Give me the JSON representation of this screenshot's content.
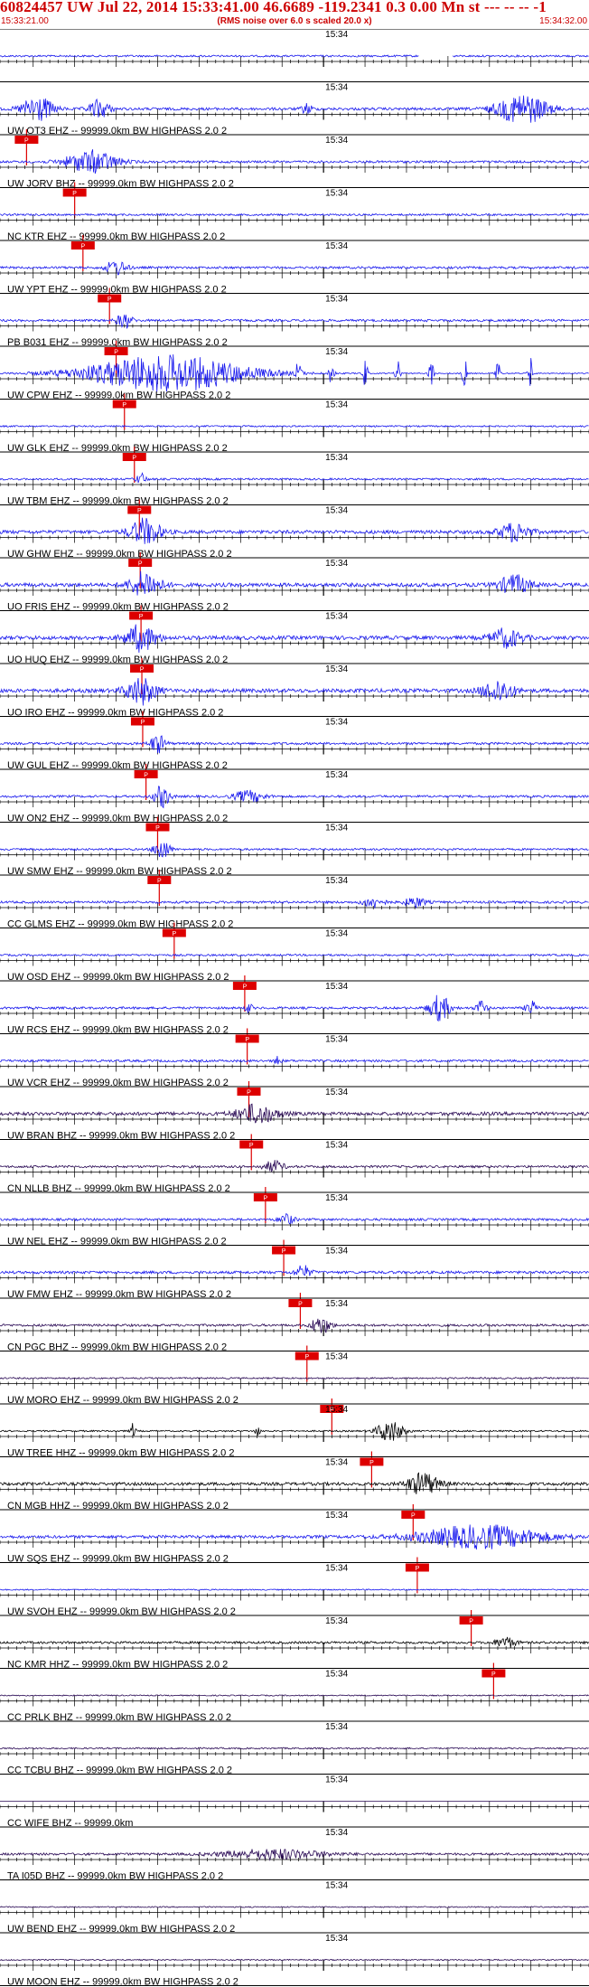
{
  "header": {
    "title": "60824457 UW Jul 22, 2014 15:33:41.00   46.6689 -119.2341  0.3 0.00 Mn st --- -- --  -1",
    "start_time": "15:33:21.00",
    "noise_note": "(RMS noise over 6.0 s scaled 20.0 x)",
    "end_time": "15:34:32.00"
  },
  "chart_data": {
    "type": "line",
    "description_time_axis": "one minute tick mark labelled 15:34 on every trace",
    "time_start": "15:33:21.00",
    "time_end": "15:34:32.00",
    "minute_tick_label": "15:34",
    "minute_tick_seconds": 39,
    "duration_seconds": 71,
    "colors": {
      "blue": "#1a1aee",
      "dark": "#2a0a55",
      "black": "#000000",
      "pick": "#dd0000"
    },
    "traces": [
      {
        "label": "",
        "pick": "",
        "pick_sec": null,
        "color": "blue",
        "amp": 0.25,
        "gaps": [
          [
            50.5,
            54.5
          ]
        ],
        "bursts": []
      },
      {
        "label": "UW OT3 EHZ -- 99999.0km BW  HIGHPASS  2.0  2",
        "pick": "P",
        "pick_sec": 3.2,
        "color": "blue",
        "amp": 0.35,
        "gaps": [],
        "bursts": [
          [
            4.5,
            3.0,
            3.5
          ],
          [
            12,
            2.0,
            2.5
          ],
          [
            37,
            1.0,
            1.5
          ],
          [
            63,
            5.0,
            4.0
          ]
        ]
      },
      {
        "label": "UW JORV BHZ -- 99999.0km BW  HIGHPASS  2.0  2",
        "pick": "P",
        "pick_sec": 9.0,
        "color": "blue",
        "amp": 0.3,
        "gaps": [],
        "bursts": [
          [
            11,
            5.0,
            3.0
          ]
        ]
      },
      {
        "label": "NC KTR EHZ -- 99999.0km BW  HIGHPASS  2.0  2",
        "pick": "P",
        "pick_sec": 10.0,
        "color": "blue",
        "amp": 0.25,
        "gaps": [],
        "bursts": []
      },
      {
        "label": "UW YPT EHZ -- 99999.0km BW  HIGHPASS  2.0  2",
        "pick": "P",
        "pick_sec": 13.2,
        "color": "blue",
        "amp": 0.3,
        "gaps": [],
        "bursts": [
          [
            14,
            2.0,
            2.0
          ]
        ]
      },
      {
        "label": "PB B031 EHZ -- 99999.0km BW  HIGHPASS  2.0  2",
        "pick": "P",
        "pick_sec": 14.0,
        "color": "blue",
        "amp": 0.3,
        "gaps": [],
        "bursts": [
          [
            15,
            1.5,
            2.0
          ]
        ]
      },
      {
        "label": "UW CPW EHZ -- 99999.0km BW  HIGHPASS  2.0  2",
        "pick": "P",
        "pick_sec": 15.0,
        "color": "blue",
        "amp": 0.15,
        "gaps": [],
        "bursts": [
          [
            20,
            16.0,
            5.0
          ],
          [
            36,
            0.5,
            4.0
          ],
          [
            40,
            0.5,
            4.0
          ],
          [
            44,
            0.5,
            4.0
          ],
          [
            48,
            0.5,
            4.0
          ],
          [
            52,
            0.5,
            4.0
          ],
          [
            56,
            0.5,
            4.0
          ],
          [
            60,
            0.5,
            4.0
          ],
          [
            64,
            0.5,
            4.0
          ]
        ]
      },
      {
        "label": "UW GLK EHZ -- 99999.0km BW  HIGHPASS  2.0  2",
        "pick": "P",
        "pick_sec": 16.2,
        "color": "blue",
        "amp": 0.2,
        "gaps": [],
        "bursts": []
      },
      {
        "label": "UW TBM EHZ -- 99999.0km BW  HIGHPASS  2.0  2",
        "pick": "P",
        "pick_sec": 16.8,
        "color": "blue",
        "amp": 0.25,
        "gaps": [],
        "bursts": [
          [
            17,
            1.0,
            1.5
          ]
        ]
      },
      {
        "label": "UW GHW EHZ -- 99999.0km BW  HIGHPASS  2.0  2",
        "pick": "P",
        "pick_sec": 16.9,
        "color": "blue",
        "amp": 0.45,
        "gaps": [],
        "bursts": [
          [
            17.5,
            3.0,
            3.5
          ],
          [
            62,
            3.0,
            2.5
          ]
        ]
      },
      {
        "label": "UO FRIS EHZ -- 99999.0km BW  HIGHPASS  2.0  2",
        "pick": "P",
        "pick_sec": 17.0,
        "color": "blue",
        "amp": 0.5,
        "gaps": [],
        "bursts": [
          [
            17.5,
            3.0,
            3.5
          ],
          [
            62,
            3.0,
            2.5
          ]
        ]
      },
      {
        "label": "UO HUQ EHZ -- 99999.0km BW  HIGHPASS  2.0  2",
        "pick": "P",
        "pick_sec": 17.1,
        "color": "blue",
        "amp": 0.5,
        "gaps": [],
        "bursts": [
          [
            17,
            3.0,
            3.5
          ],
          [
            61,
            3.0,
            2.5
          ]
        ]
      },
      {
        "label": "UO IRO EHZ -- 99999.0km BW  HIGHPASS  2.0  2",
        "pick": "P",
        "pick_sec": 17.2,
        "color": "blue",
        "amp": 0.5,
        "gaps": [],
        "bursts": [
          [
            17,
            3.0,
            3.5
          ],
          [
            60,
            3.0,
            3.0
          ]
        ]
      },
      {
        "label": "UW GUL EHZ -- 99999.0km BW  HIGHPASS  2.0  2",
        "pick": "P",
        "pick_sec": 17.6,
        "color": "blue",
        "amp": 0.3,
        "gaps": [],
        "bursts": [
          [
            19,
            1.5,
            2.5
          ]
        ]
      },
      {
        "label": "UW ON2 EHZ -- 99999.0km BW  HIGHPASS  2.0  2",
        "pick": "P",
        "pick_sec": 19.0,
        "color": "blue",
        "amp": 0.3,
        "gaps": [],
        "bursts": [
          [
            19.5,
            1.5,
            3.0
          ],
          [
            30,
            3.0,
            1.5
          ]
        ]
      },
      {
        "label": "UW SMW EHZ -- 99999.0km BW  HIGHPASS  2.0  2",
        "pick": "P",
        "pick_sec": 19.2,
        "color": "blue",
        "amp": 0.25,
        "gaps": [],
        "bursts": [
          [
            19.5,
            1.5,
            3.0
          ]
        ]
      },
      {
        "label": "CC GLMS EHZ -- 99999.0km BW  HIGHPASS  2.0  2",
        "pick": "P",
        "pick_sec": 21.0,
        "color": "blue",
        "amp": 0.3,
        "gaps": [],
        "bursts": [
          [
            45,
            2.0,
            1.5
          ],
          [
            50,
            2.0,
            1.4
          ]
        ]
      },
      {
        "label": "UW OSD EHZ -- 99999.0km BW  HIGHPASS  2.0  2",
        "pick": "P",
        "pick_sec": 29.5,
        "color": "blue",
        "amp": 0.25,
        "gaps": [],
        "bursts": []
      },
      {
        "label": "UW RCS EHZ -- 99999.0km BW  HIGHPASS  2.0  2",
        "pick": "P",
        "pick_sec": 29.8,
        "color": "blue",
        "amp": 0.3,
        "gaps": [],
        "bursts": [
          [
            30,
            0.6,
            1.5
          ],
          [
            53,
            2.0,
            3.5
          ],
          [
            58,
            1.0,
            2.0
          ],
          [
            64,
            1.0,
            2.0
          ]
        ]
      },
      {
        "label": "UW VCR EHZ -- 99999.0km BW  HIGHPASS  2.0  2",
        "pick": "P",
        "pick_sec": 30.0,
        "color": "blue",
        "amp": 0.3,
        "gaps": [],
        "bursts": [
          [
            33.5,
            0.6,
            1.5
          ]
        ]
      },
      {
        "label": "UW BRAN BHZ -- 99999.0km BW  HIGHPASS  2.0  2",
        "pick": "P",
        "pick_sec": 30.3,
        "color": "dark",
        "amp": 0.45,
        "gaps": [],
        "bursts": [
          [
            31,
            4.0,
            2.5
          ]
        ]
      },
      {
        "label": "CN NLLB BHZ -- 99999.0km BW  HIGHPASS  2.0  2",
        "pick": "P",
        "pick_sec": 32.0,
        "color": "dark",
        "amp": 0.3,
        "gaps": [],
        "bursts": [
          [
            33,
            2.0,
            1.5
          ]
        ]
      },
      {
        "label": "UW NEL EHZ -- 99999.0km BW  HIGHPASS  2.0  2",
        "pick": "P",
        "pick_sec": 34.2,
        "color": "blue",
        "amp": 0.3,
        "gaps": [],
        "bursts": [
          [
            34.5,
            1.5,
            1.5
          ]
        ]
      },
      {
        "label": "UW FMW EHZ -- 99999.0km BW  HIGHPASS  2.0  2",
        "pick": "P",
        "pick_sec": 36.2,
        "color": "blue",
        "amp": 0.35,
        "gaps": [],
        "bursts": [
          [
            36.5,
            1.5,
            1.8
          ]
        ]
      },
      {
        "label": "CN PGC BHZ -- 99999.0km BW  HIGHPASS  2.0  2",
        "pick": "P",
        "pick_sec": 37.0,
        "color": "dark",
        "amp": 0.3,
        "gaps": [],
        "bursts": [
          [
            38,
            1.0,
            1.3
          ],
          [
            39,
            1.5,
            2.0
          ]
        ]
      },
      {
        "label": "UW MORO EHZ -- 99999.0km BW  HIGHPASS  2.0  2",
        "pick": "P",
        "pick_sec": 40.0,
        "color": "dark",
        "amp": 0.2,
        "gaps": [],
        "bursts": []
      },
      {
        "label": "UW TREE HHZ -- 99999.0km BW  HIGHPASS  2.0  2",
        "pick": "P",
        "pick_sec": 44.8,
        "color": "black",
        "amp": 0.2,
        "gaps": [],
        "bursts": [
          [
            16,
            0.5,
            2.0
          ],
          [
            31,
            0.5,
            1.5
          ],
          [
            47,
            2.5,
            3.0
          ]
        ]
      },
      {
        "label": "CN MGB HHZ -- 99999.0km BW  HIGHPASS  2.0  2",
        "pick": "P",
        "pick_sec": 49.8,
        "color": "black",
        "amp": 0.4,
        "gaps": [],
        "bursts": [
          [
            51,
            3.0,
            3.0
          ]
        ]
      },
      {
        "label": "UW SQS EHZ -- 99999.0km BW  HIGHPASS  2.0  2",
        "pick": "P",
        "pick_sec": 50.3,
        "color": "blue",
        "amp": 0.4,
        "gaps": [],
        "bursts": [
          [
            58,
            12.0,
            3.0
          ]
        ]
      },
      {
        "label": "UW SVOH EHZ -- 99999.0km BW  HIGHPASS  2.0  2",
        "pick": "P",
        "pick_sec": 56.8,
        "color": "blue",
        "amp": 0.15,
        "gaps": [],
        "bursts": []
      },
      {
        "label": "NC KMR HHZ -- 99999.0km BW  HIGHPASS  2.0  2",
        "pick": "P",
        "pick_sec": 59.5,
        "color": "black",
        "amp": 0.3,
        "gaps": [],
        "bursts": [
          [
            61,
            2.0,
            1.5
          ]
        ]
      },
      {
        "label": "CC PRLK BHZ -- 99999.0km BW  HIGHPASS  2.0  2",
        "pick": "",
        "pick_sec": null,
        "color": "dark",
        "amp": 0.15,
        "gaps": [],
        "bursts": []
      },
      {
        "label": "CC TCBU BHZ -- 99999.0km BW  HIGHPASS  2.0  2",
        "pick": "",
        "pick_sec": null,
        "color": "dark",
        "amp": 0.2,
        "gaps": [],
        "bursts": []
      },
      {
        "label": "CC WIFE BHZ -- 99999.0km",
        "pick": "",
        "pick_sec": null,
        "color": "dark",
        "amp": 0.0,
        "gaps": [],
        "bursts": []
      },
      {
        "label": "TA I05D BHZ -- 99999.0km BW  HIGHPASS  2.0  2",
        "pick": "",
        "pick_sec": null,
        "color": "dark",
        "amp": 0.3,
        "gaps": [],
        "bursts": [
          [
            33,
            10.0,
            1.3
          ]
        ]
      },
      {
        "label": "UW BEND EHZ -- 99999.0km BW  HIGHPASS  2.0  2",
        "pick": "",
        "pick_sec": null,
        "color": "dark",
        "amp": 0.15,
        "gaps": [],
        "bursts": []
      },
      {
        "label": "UW MOON EHZ -- 99999.0km BW  HIGHPASS  2.0  2",
        "pick": "",
        "pick_sec": null,
        "color": "dark",
        "amp": 0.15,
        "gaps": [],
        "bursts": []
      }
    ]
  }
}
